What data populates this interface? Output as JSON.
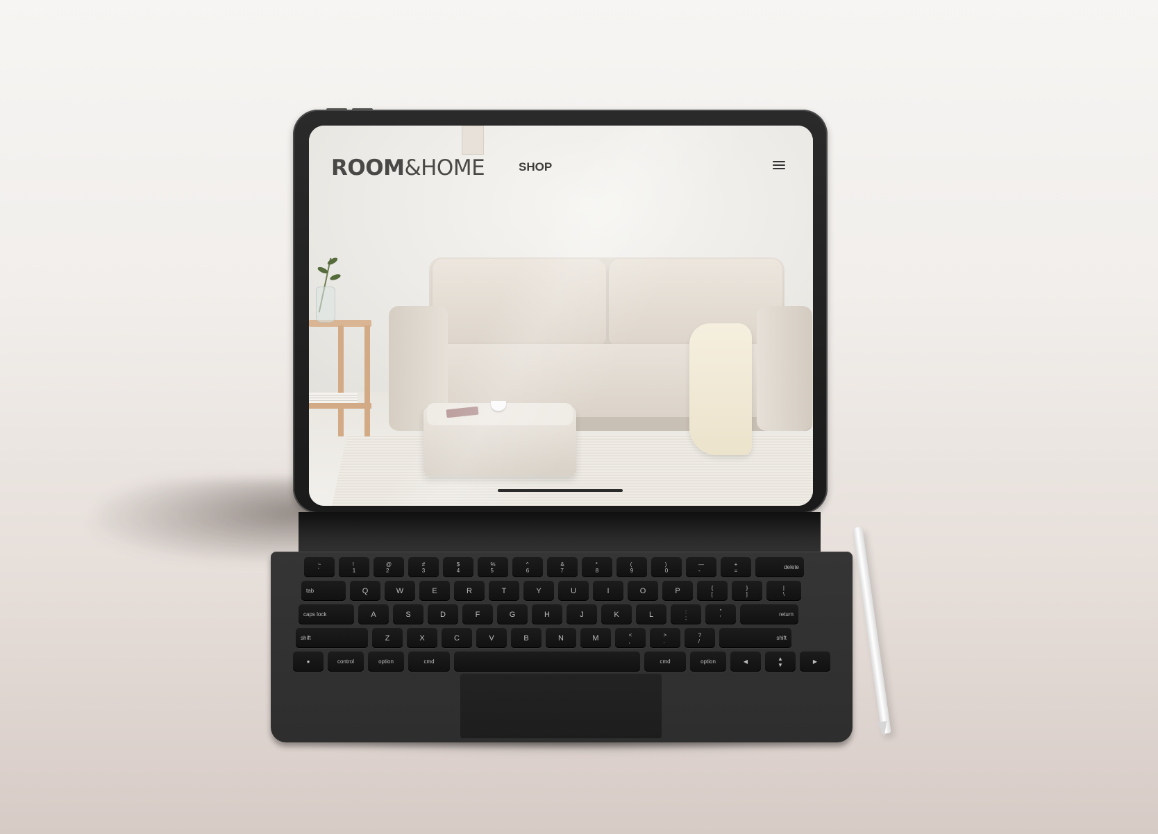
{
  "site": {
    "logo_bold": "ROOM",
    "logo_amp": "&",
    "logo_rest": "HOME",
    "nav_shop": "SHOP",
    "menu_icon": "hamburger-icon"
  },
  "keyboard": {
    "row1": [
      "~\n`",
      "!\n1",
      "@\n2",
      "#\n3",
      "$\n4",
      "%\n5",
      "^\n6",
      "&\n7",
      "*\n8",
      "(\n9",
      ")\n0",
      "—\n-",
      "+\n=",
      "delete"
    ],
    "row2": [
      "tab",
      "Q",
      "W",
      "E",
      "R",
      "T",
      "Y",
      "U",
      "I",
      "O",
      "P",
      "{\n[",
      "}\n]",
      "|\n\\"
    ],
    "row3": [
      "caps lock",
      "A",
      "S",
      "D",
      "F",
      "G",
      "H",
      "J",
      "K",
      "L",
      ":\n;",
      "\"\n'",
      "return"
    ],
    "row4": [
      "shift",
      "Z",
      "X",
      "C",
      "V",
      "B",
      "N",
      "M",
      "<\n,",
      ">\n.",
      "?\n/",
      "shift"
    ],
    "row5": [
      "●",
      "control",
      "option",
      "cmd",
      "",
      "cmd",
      "option",
      "◀",
      "▲\n▼",
      "▶"
    ]
  }
}
